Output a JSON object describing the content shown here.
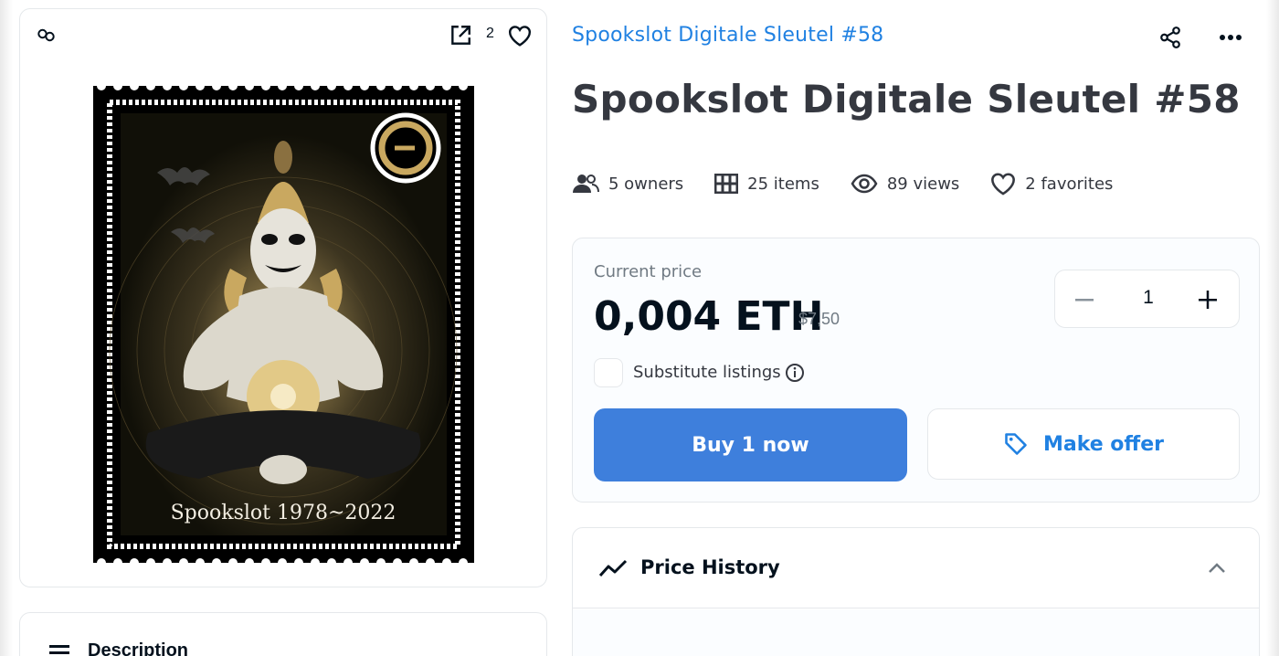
{
  "image_card": {
    "favorite_count": "2",
    "icons": [
      "chain-link-icon",
      "open-external-icon",
      "heart-icon"
    ],
    "artwork": {
      "stamp_text": "Spookslot 1978~2022",
      "colors": {
        "background": "#000000",
        "gold": "#c9a860",
        "border": "#ffffff"
      }
    }
  },
  "description_card": {
    "title": "Description",
    "icon": "menu-lines-icon"
  },
  "header": {
    "collection_name": "Spookslot Digitale Sleutel #58",
    "item_title": "Spookslot Digitale Sleutel #58",
    "actions": [
      "share-icon",
      "more-icon"
    ]
  },
  "stats": [
    {
      "icon": "people-icon",
      "label": "5 owners"
    },
    {
      "icon": "grid-icon",
      "label": "25 items"
    },
    {
      "icon": "eye-icon",
      "label": "89 views"
    },
    {
      "icon": "heart-icon",
      "label": "2 favorites"
    }
  ],
  "price": {
    "label": "Current price",
    "amount": "0,004 ETH",
    "fiat": "$7,50",
    "quantity": "1",
    "substitute_label": "Substitute listings",
    "substitute_checked": false,
    "buy_label": "Buy 1 now",
    "offer_label": "Make offer"
  },
  "price_history": {
    "title": "Price History",
    "expanded": true
  },
  "colors": {
    "accent": "#2081e2",
    "buy_button": "#3e7fdc",
    "border": "#e5e8eb",
    "text_dark": "#04111d",
    "text_secondary": "#707a83"
  }
}
